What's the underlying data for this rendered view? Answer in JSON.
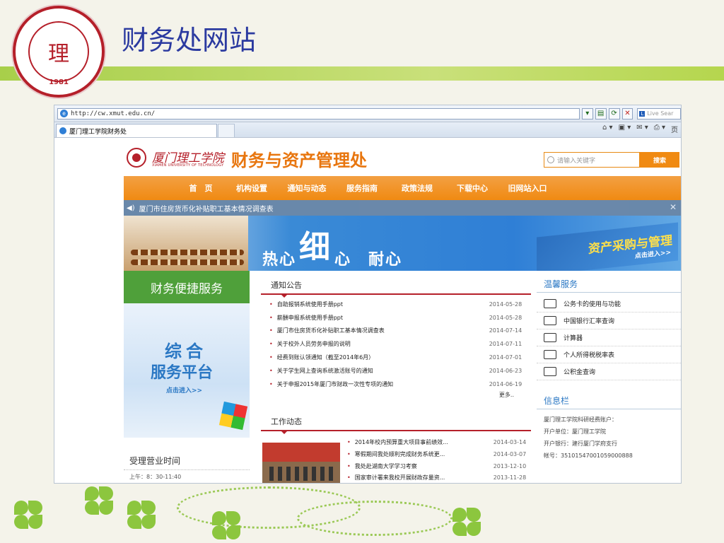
{
  "slide": {
    "title": "财务处网站",
    "logo_text": "理",
    "logo_year": "1981"
  },
  "browser": {
    "url": "http://cw.xmut.edu.cn/",
    "search_placeholder": "Live Sear",
    "tab_title": "厦门理工学院财务处",
    "page_label": "页"
  },
  "site": {
    "school_name": "厦门理工学院",
    "school_sub": "XIAMEN UNIVERSITY OF TECHNOLOGY",
    "dept_name": "财务与资产管理处",
    "search_placeholder": "请输入关键字",
    "search_button": "搜索",
    "nav": [
      "首　页",
      "机构设置",
      "通知与动态",
      "服务指南",
      "政策法规",
      "下载中心",
      "旧网站入口"
    ],
    "notice": "厦门市住房货币化补贴职工基本情况调查表",
    "banner": {
      "slogan_a": "热心",
      "slogan_big": "细",
      "slogan_b": "心　耐心",
      "ribbon_title": "资产采购与管理",
      "ribbon_link": "点击进入>>"
    },
    "left": {
      "service_title": "财务便捷服务",
      "platform_l1": "综合",
      "platform_l2": "服务平台",
      "platform_link": "点击进入>>",
      "hours_title": "受理营业时间",
      "hours_value": "上午：8：30-11:40"
    },
    "notices": {
      "title": "通知公告",
      "items": [
        {
          "text": "自助报销系统使用手册ppt",
          "date": "2014-05-28"
        },
        {
          "text": "薪酬申报系统使用手册ppt",
          "date": "2014-05-28"
        },
        {
          "text": "厦门市住房货币化补贴职工基本情况调查表",
          "date": "2014-07-14"
        },
        {
          "text": "关于校外人员劳务申报的说明",
          "date": "2014-07-11"
        },
        {
          "text": "经费到账认领通知（截至2014年6月）",
          "date": "2014-07-01"
        },
        {
          "text": "关于学生网上查询系统激活账号的通知",
          "date": "2014-06-23"
        },
        {
          "text": "关于申报2015年厦门市财政一次性专项的通知",
          "date": "2014-06-19"
        }
      ],
      "more": "更多.."
    },
    "work": {
      "title": "工作动态",
      "items": [
        {
          "text": "2014年校内预算重大项目事前绩效...",
          "date": "2014-03-14"
        },
        {
          "text": "寒假期间我处顺利完成财务系统更...",
          "date": "2014-03-07"
        },
        {
          "text": "我处赴湖南大学学习考察",
          "date": "2013-12-10"
        },
        {
          "text": "国家审计署来我校开展财政存量资...",
          "date": "2013-11-28"
        }
      ]
    },
    "services": {
      "title": "温馨服务",
      "items": [
        {
          "label": "公务卡的使用与功能",
          "icon": "card-icon"
        },
        {
          "label": "中国银行汇率查询",
          "icon": "exchange-icon"
        },
        {
          "label": "计算器",
          "icon": "calculator-icon"
        },
        {
          "label": "个人所得税税率表",
          "icon": "piggy-bank-icon"
        },
        {
          "label": "公积金查询",
          "icon": "coins-icon"
        }
      ]
    },
    "info": {
      "title": "信息栏",
      "lines": [
        "厦门理工学院科研经费账户：",
        "开户单位：厦门理工学院",
        "开户银行：建行厦门学府支行",
        "帐号：35101547001059000888"
      ]
    }
  }
}
